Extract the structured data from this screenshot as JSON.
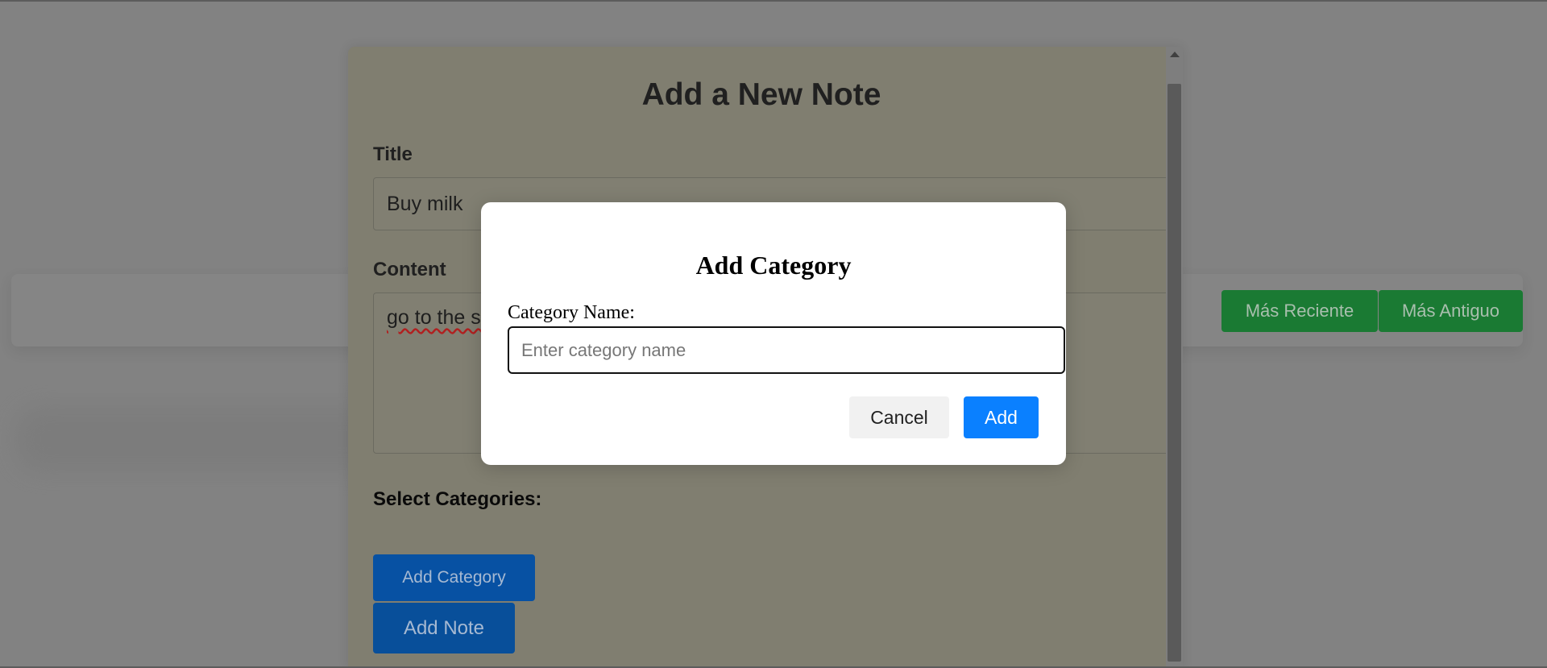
{
  "sort": {
    "newest_label": "Más Reciente",
    "oldest_label": "Más Antiguo"
  },
  "note_form": {
    "heading": "Add a New Note",
    "title_label": "Title",
    "title_value": "Buy milk",
    "content_label": "Content",
    "content_value": "go to the s",
    "categories_label": "Select Categories:",
    "add_category_label": "Add Category",
    "add_note_label": "Add Note"
  },
  "modal": {
    "title": "Add Category",
    "field_label": "Category Name:",
    "placeholder": "Enter category name",
    "cancel_label": "Cancel",
    "add_label": "Add"
  },
  "colors": {
    "overlay": "#828282",
    "primary": "#0a80ff",
    "success": "#1a7a33"
  }
}
